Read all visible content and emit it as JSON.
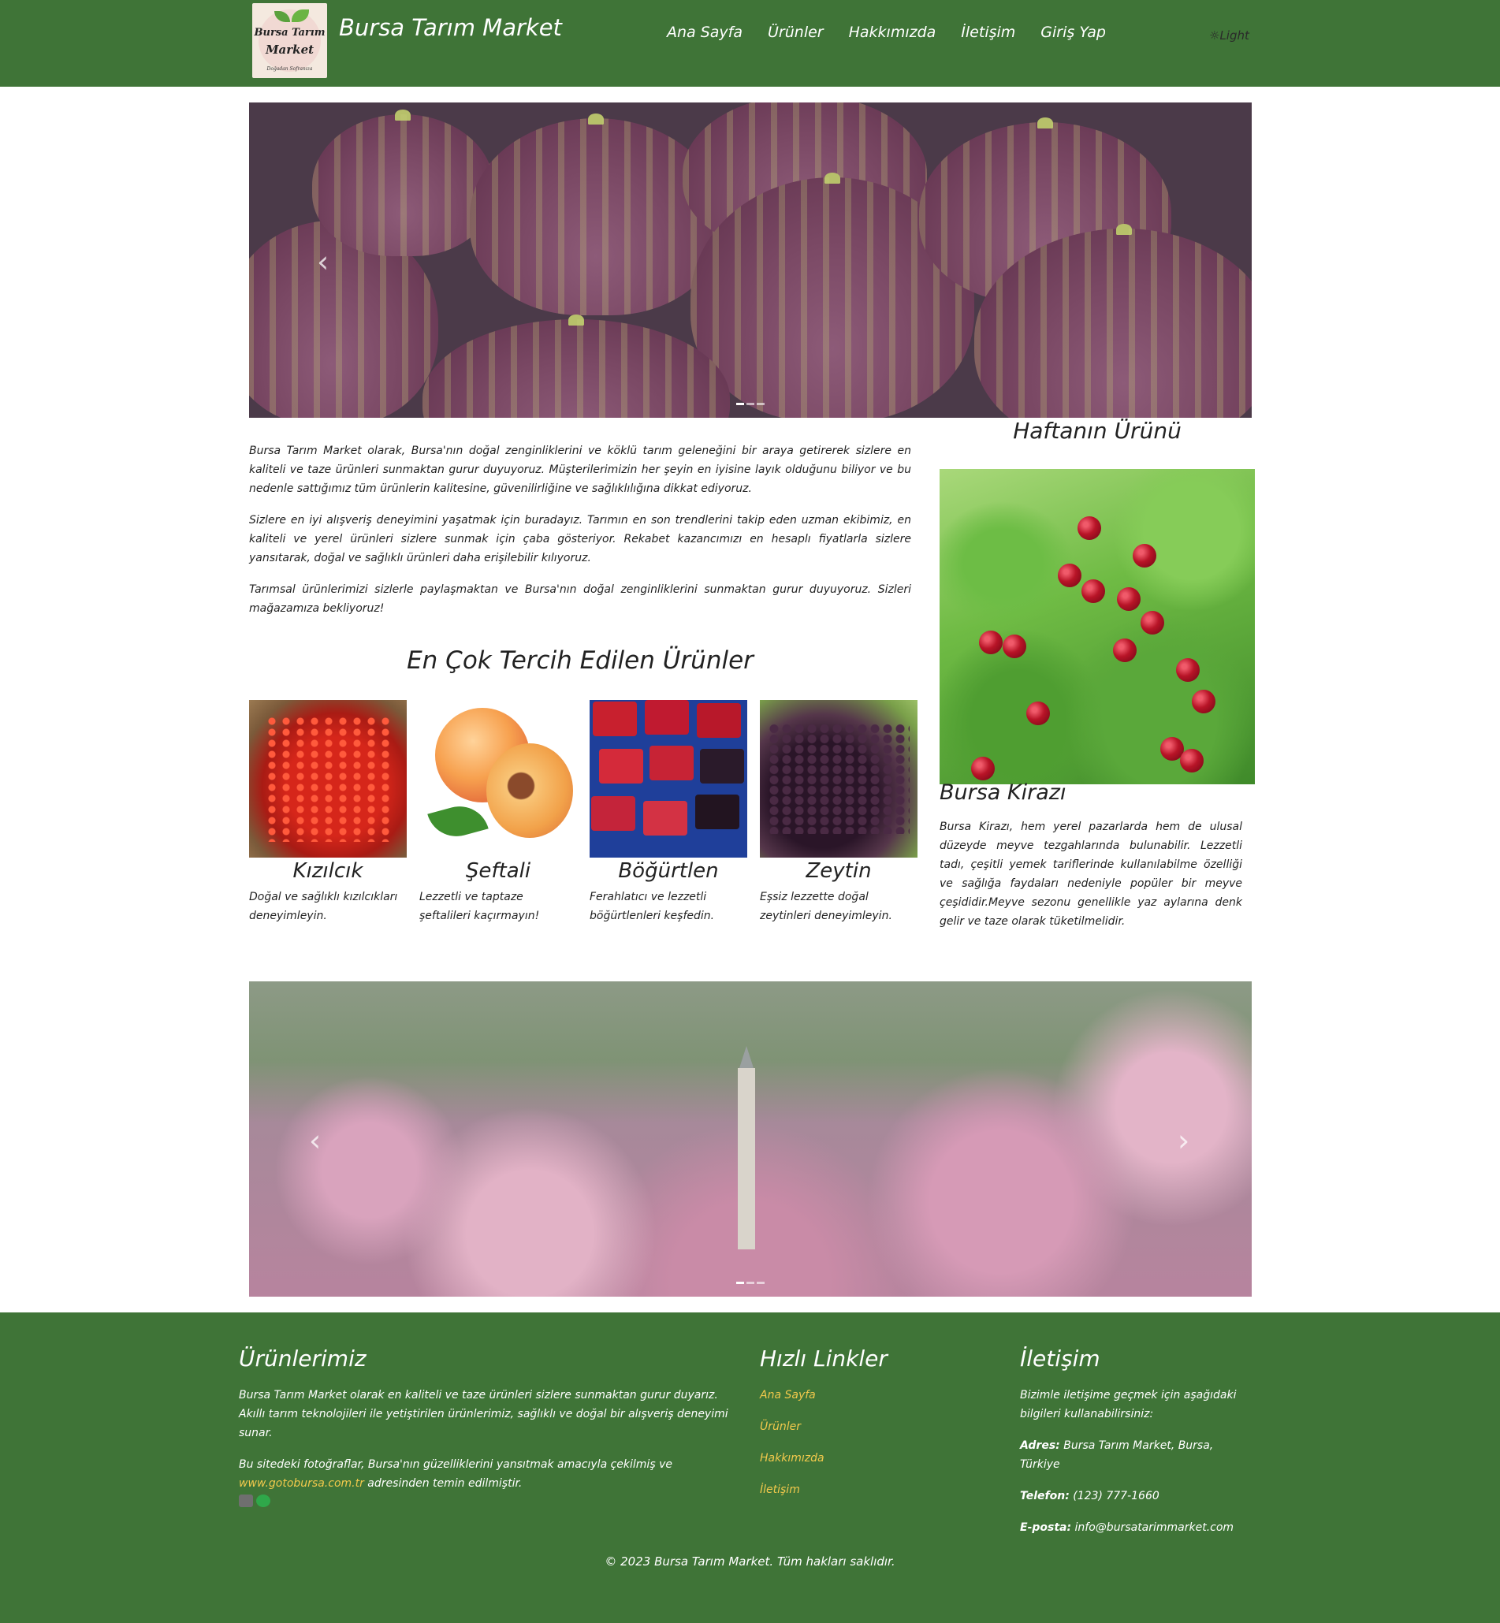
{
  "header": {
    "logo_line1": "Bursa Tarım",
    "logo_line2": "Market",
    "logo_line3": "Doğadan Sofranıza",
    "title": "Bursa Tarım Market",
    "nav": [
      "Ana Sayfa",
      "Ürünler",
      "Hakkımızda",
      "İletişim",
      "Giriş Yap"
    ],
    "theme_toggle": "☼Light"
  },
  "carousel_top": {
    "prev_icon": "‹",
    "slides": 3,
    "active": 1
  },
  "intro": [
    "Bursa Tarım Market olarak, Bursa'nın doğal zenginliklerini ve köklü tarım geleneğini bir araya getirerek sizlere en kaliteli ve taze ürünleri sunmaktan gurur duyuyoruz. Müşterilerimizin her şeyin en iyisine layık olduğunu biliyor ve bu nedenle sattığımız tüm ürünlerin kalitesine, güvenilirliğine ve sağlıklılığına dikkat ediyoruz.",
    "Sizlere en iyi alışveriş deneyimini yaşatmak için buradayız. Tarımın en son trendlerini takip eden uzman ekibimiz, en kaliteli ve yerel ürünleri sizlere sunmak için çaba gösteriyor. Rekabet kazancımızı en hesaplı fiyatlarla sizlere yansıtarak, doğal ve sağlıklı ürünleri daha erişilebilir kılıyoruz.",
    "Tarımsal ürünlerimizi sizlerle paylaşmaktan ve Bursa'nın doğal zenginliklerini sunmaktan gurur duyuyoruz. Sizleri mağazamıza bekliyoruz!"
  ],
  "popular": {
    "title": "En Çok Tercih Edilen Ürünler",
    "products": [
      {
        "name": "Kızılcık",
        "desc": "Doğal ve sağlıklı kızılcıkları deneyimleyin."
      },
      {
        "name": "Şeftali",
        "desc": "Lezzetli ve taptaze şeftalileri kaçırmayın!"
      },
      {
        "name": "Böğürtlen",
        "desc": "Ferahlatıcı ve lezzetli böğürtlenleri keşfedin."
      },
      {
        "name": "Zeytin",
        "desc": "Eşsiz lezzette doğal zeytinleri deneyimleyin."
      }
    ]
  },
  "week": {
    "title": "Haftanın Ürünü",
    "name": "Bursa Kirazı",
    "desc": "Bursa Kirazı, hem yerel pazarlarda hem de ulusal düzeyde meyve tezgahlarında bulunabilir. Lezzetli tadı, çeşitli yemek tariflerinde kullanılabilme özelliği ve sağlığa faydaları nedeniyle popüler bir meyve çeşididir.Meyve sezonu genellikle yaz aylarına denk gelir ve taze olarak tüketilmelidir."
  },
  "carousel_bottom": {
    "prev_icon": "‹",
    "next_icon": "›",
    "slides": 3,
    "active": 1
  },
  "footer": {
    "products": {
      "title": "Ürünlerimiz",
      "p1": "Bursa Tarım Market olarak en kaliteli ve taze ürünleri sizlere sunmaktan gurur duyarız. Akıllı tarım teknolojileri ile yetiştirilen ürünlerimiz, sağlıklı ve doğal bir alışveriş deneyimi sunar.",
      "p2_before": "Bu sitedeki fotoğraflar, Bursa'nın güzelliklerini yansıtmak amacıyla çekilmiş ve ",
      "p2_link": "www.gotobursa.com.tr",
      "p2_after": " adresinden temin edilmiştir."
    },
    "quick": {
      "title": "Hızlı Linkler",
      "links": [
        "Ana Sayfa",
        "Ürünler",
        "Hakkımızda",
        "İletişim"
      ]
    },
    "contact": {
      "title": "İletişim",
      "intro": "Bizimle iletişime geçmek için aşağıdaki bilgileri kullanabilirsiniz:",
      "address_label": "Adres:",
      "address": " Bursa Tarım Market, Bursa, Türkiye",
      "phone_label": "Telefon:",
      "phone": " (123) 777-1660",
      "email_label": "E-posta:",
      "email": " info@bursatarimmarket.com"
    },
    "copyright": "© 2023 Bursa Tarım Market. Tüm hakları saklıdır."
  },
  "colors": {
    "brand_green": "#3f7437",
    "link_yellow": "#f2c94c"
  }
}
